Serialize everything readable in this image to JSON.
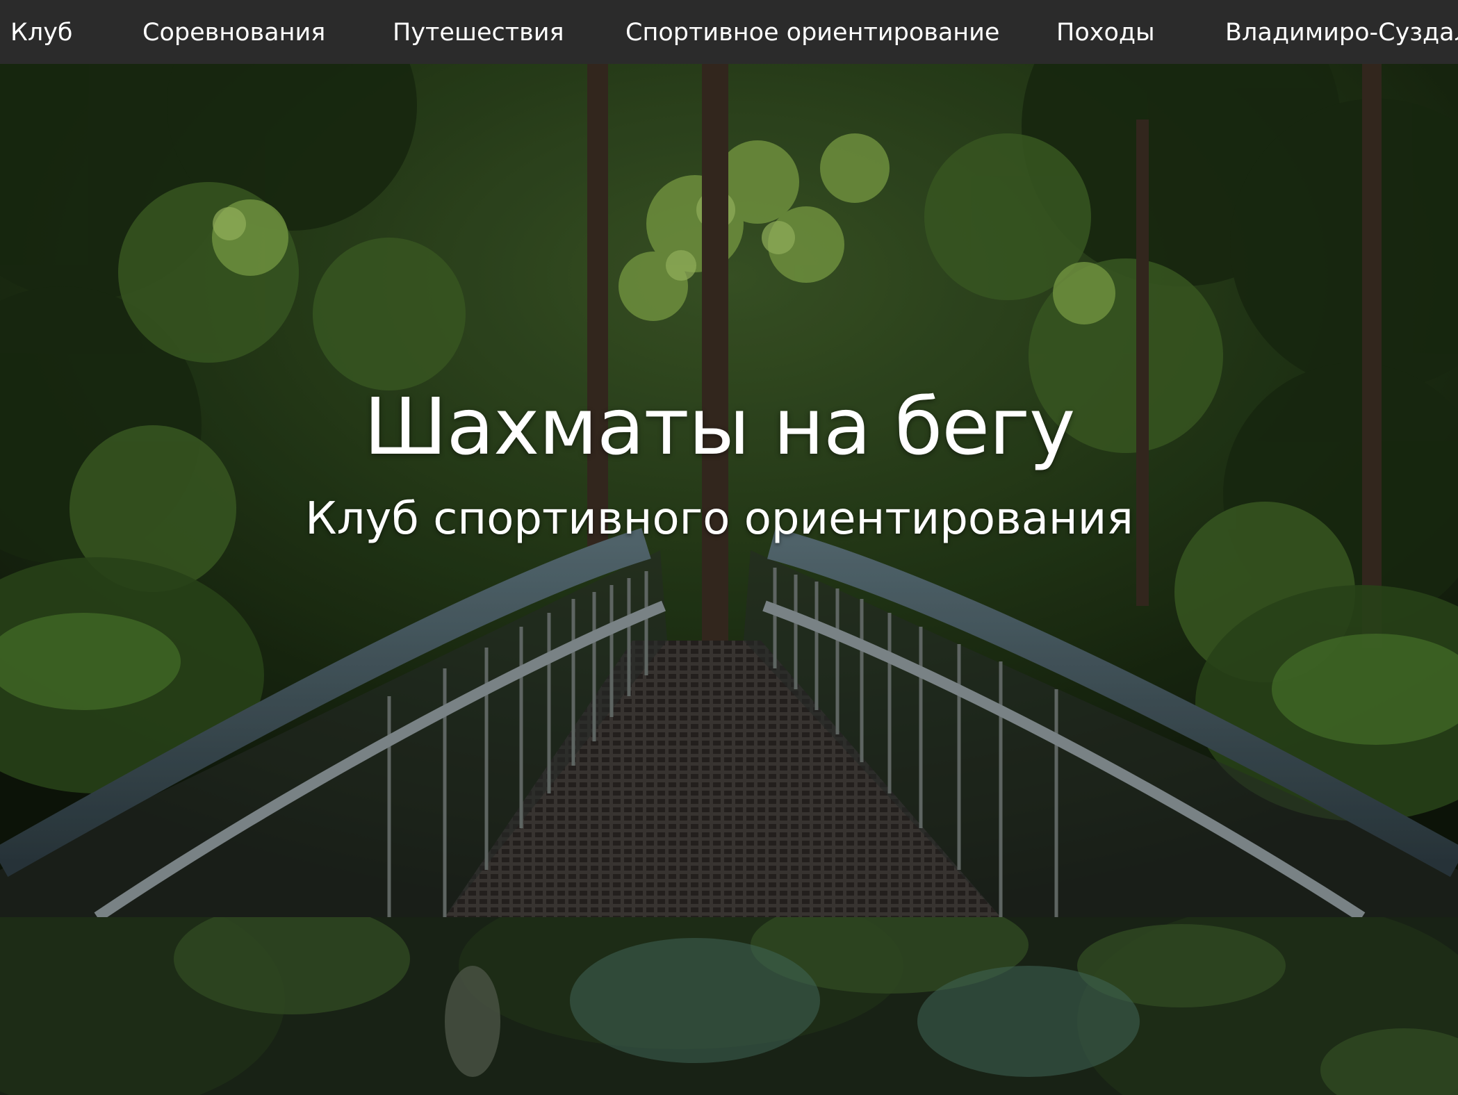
{
  "nav": {
    "items": [
      {
        "label": "Клуб"
      },
      {
        "label": "Соревнования"
      },
      {
        "label": "Путешествия"
      },
      {
        "label": "Спортивное ориентирование"
      },
      {
        "label": "Походы"
      },
      {
        "label": "Владимиро-Суздаль"
      }
    ]
  },
  "hero": {
    "title": "Шахматы на бегу",
    "subtitle": "Клуб спортивного ориентирования",
    "background_image": "forest-bridge-photo"
  },
  "section_two": {
    "background_image": "forest-canopy-photo"
  },
  "colors": {
    "navbar_bg": "#2b2b2b",
    "nav_text": "#ffffff",
    "hero_text": "#ffffff"
  }
}
